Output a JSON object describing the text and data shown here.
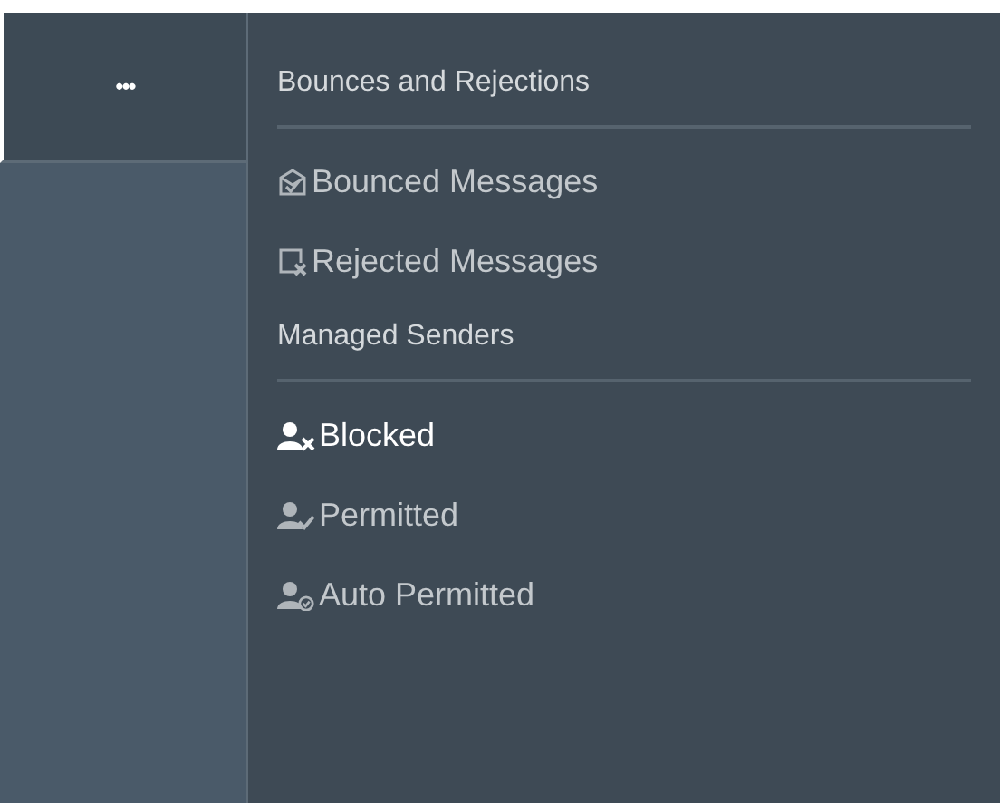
{
  "rail": {
    "more_tab": {
      "label": "•••",
      "selected": true
    }
  },
  "sections": [
    {
      "heading": "Bounces and Rejections",
      "items": [
        {
          "kind": "bounced",
          "label": "Bounced Messages",
          "selected": false
        },
        {
          "kind": "rejected",
          "label": "Rejected Messages",
          "selected": false
        }
      ]
    },
    {
      "heading": "Managed Senders",
      "items": [
        {
          "kind": "blocked",
          "label": "Blocked",
          "selected": true
        },
        {
          "kind": "permitted",
          "label": "Permitted",
          "selected": false
        },
        {
          "kind": "auto-permitted",
          "label": "Auto Permitted",
          "selected": false
        }
      ]
    }
  ]
}
